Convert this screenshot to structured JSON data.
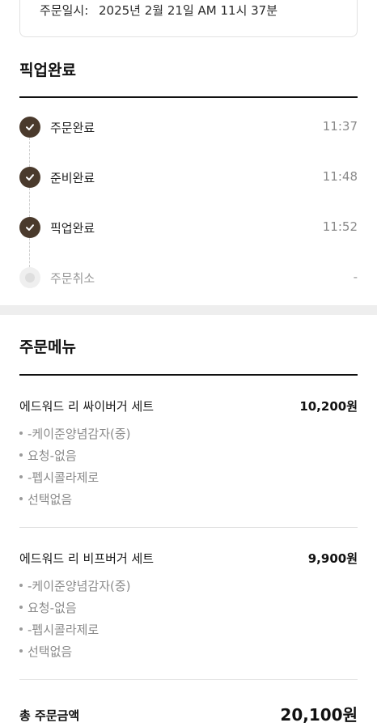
{
  "order_info": {
    "label": "주문일시:",
    "value": "2025년 2월 21일 AM 11시 37분"
  },
  "status": {
    "title": "픽업완료",
    "steps": [
      {
        "name": "주문완료",
        "time": "11:37",
        "done": true
      },
      {
        "name": "준비완료",
        "time": "11:48",
        "done": true
      },
      {
        "name": "픽업완료",
        "time": "11:52",
        "done": true
      },
      {
        "name": "주문취소",
        "time": "-",
        "done": false
      }
    ]
  },
  "menu": {
    "title": "주문메뉴",
    "items": [
      {
        "name": "에드워드 리 싸이버거 세트",
        "price": "10,200원",
        "options": [
          "-케이준양념감자(중)",
          "요청-없음",
          "-펩시콜라제로",
          "선택없음"
        ]
      },
      {
        "name": "에드워드 리 비프버거 세트",
        "price": "9,900원",
        "options": [
          "-케이준양념감자(중)",
          "요청-없음",
          "-펩시콜라제로",
          "선택없음"
        ]
      }
    ]
  },
  "total": {
    "label": "총 주문금액",
    "value": "20,100원"
  },
  "colors": {
    "done": "#4a3a2c",
    "pending": "#efefef"
  }
}
